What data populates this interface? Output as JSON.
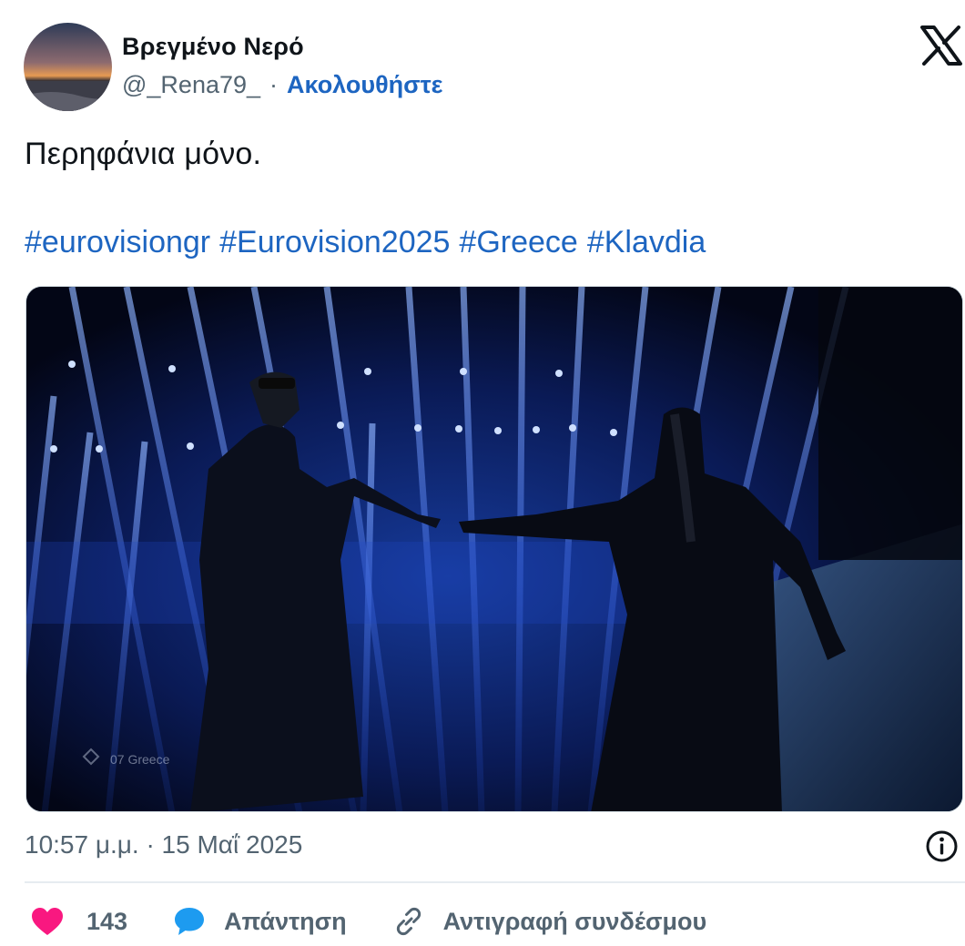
{
  "user": {
    "display_name": "Βρεγμένο Νερό",
    "handle": "@_Rena79_",
    "separator": "·",
    "follow_label": "Ακολουθήστε",
    "avatar_icon": "sunset-beach-avatar"
  },
  "tweet": {
    "text": "Περηφάνια μόνο.",
    "hashtags": [
      "#eurovisiongr",
      "#Eurovision2025",
      "#Greece",
      "#Klavdia"
    ],
    "media_watermark": "07 Greece",
    "timestamp": "10:57 μ.μ. · 15 Μαΐ 2025"
  },
  "actions": {
    "like_count": "143",
    "reply_label": "Απάντηση",
    "copy_link_label": "Αντιγραφή συνδέσμου"
  },
  "colors": {
    "link": "#1d65c1",
    "secondary_text": "#536471",
    "heart": "#f91880",
    "reply_bubble": "#1d9bf0",
    "divider": "#e6ecf0"
  }
}
